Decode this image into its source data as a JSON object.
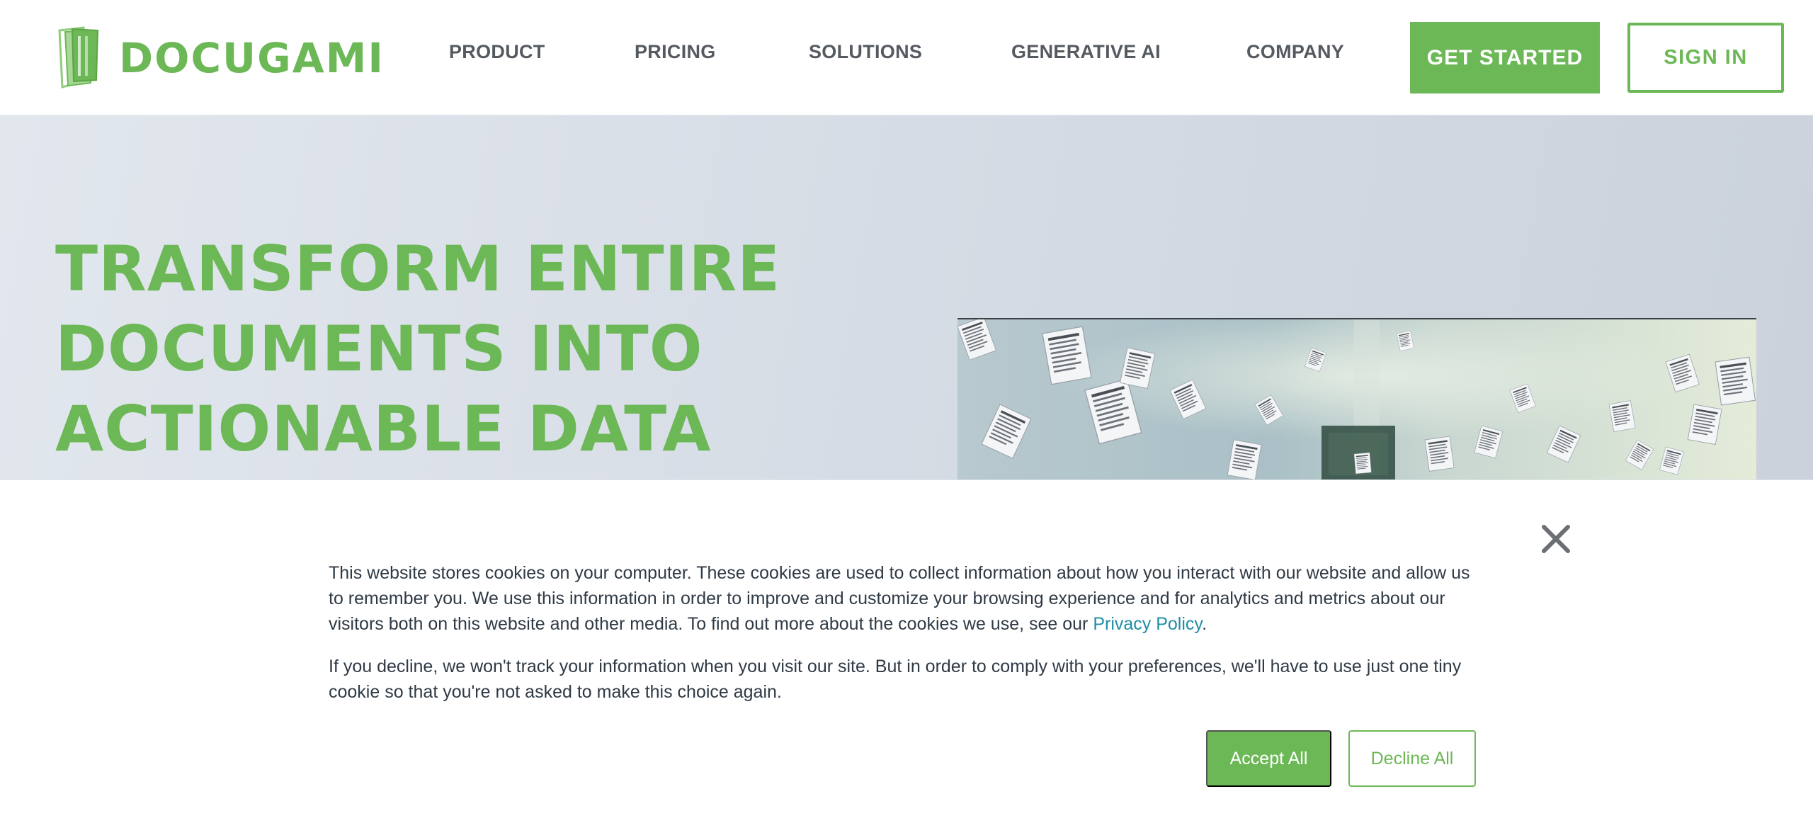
{
  "brand": {
    "name": "DOCUGAMI",
    "logo_icon": "docugami-stack-icon",
    "color": "#6cb856"
  },
  "nav": {
    "items": [
      {
        "label": "PRODUCT"
      },
      {
        "label": "PRICING"
      },
      {
        "label": "SOLUTIONS"
      },
      {
        "label": "GENERATIVE AI"
      },
      {
        "label": "COMPANY"
      }
    ],
    "get_started": "GET STARTED",
    "sign_in": "SIGN IN"
  },
  "hero": {
    "title_lines": [
      "TRANSFORM ENTIRE",
      "DOCUMENTS INTO",
      "ACTIONABLE DATA"
    ],
    "media": "flying-documents-video"
  },
  "cookie_banner": {
    "close_icon": "close-icon",
    "paragraph1_text": "This website stores cookies on your computer. These cookies are used to collect information about how you interact with our website and allow us to remember you. We use this information in order to improve and customize your browsing experience and for analytics and metrics about our visitors both on this website and other media. To find out more about the cookies we use, see our ",
    "privacy_link": "Privacy Policy",
    "paragraph1_end": ".",
    "paragraph2": "If you decline, we won't track your information when you visit our site. But in order to comply with your preferences, we'll have to use just one tiny cookie so that you're not asked to make this choice again.",
    "accept_label": "Accept All",
    "decline_label": "Decline All",
    "link_color": "#1f8ea5"
  }
}
